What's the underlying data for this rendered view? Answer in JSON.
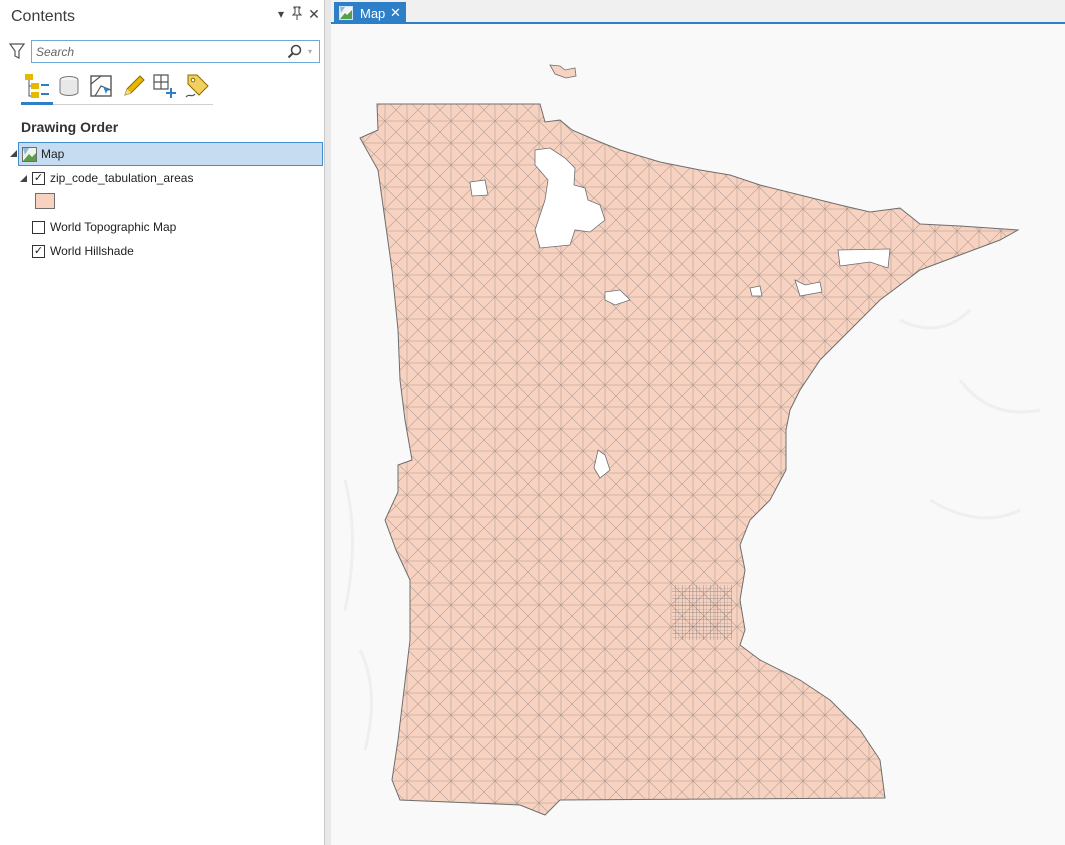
{
  "contents": {
    "title": "Contents",
    "search_placeholder": "Search",
    "section_title": "Drawing Order",
    "view_buttons": [
      "list-by-drawing-order-icon",
      "list-by-data-source-icon",
      "list-by-selection-icon",
      "list-by-editing-icon",
      "list-by-snapping-icon",
      "list-by-labeling-icon"
    ],
    "map_node": {
      "label": "Map"
    },
    "layers": [
      {
        "label": "zip_code_tabulation_areas",
        "checked": true,
        "symbol_color": "#f8d2c0"
      },
      {
        "label": "World Topographic Map",
        "checked": false
      },
      {
        "label": "World Hillshade",
        "checked": true
      }
    ]
  },
  "map_view": {
    "tab_label": "Map",
    "fill_color": "#f8d2c0",
    "outline_color": "#6e6e6e"
  },
  "colors": {
    "accent": "#2d7fc8",
    "selection": "#c6dcf0"
  }
}
